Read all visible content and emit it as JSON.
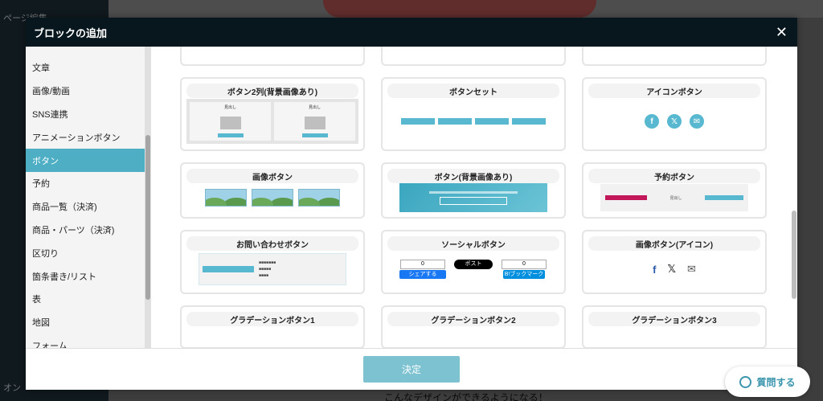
{
  "background": {
    "sidebar_rows": [
      "ページ編集",
      "オン"
    ],
    "footer_text": "こんなデザインができるようになる！"
  },
  "modal": {
    "title": "ブロックの追加",
    "close_label": "✕",
    "confirm_label": "決定"
  },
  "sidebar": {
    "items": [
      {
        "label": "文章"
      },
      {
        "label": "画像/動画"
      },
      {
        "label": "SNS連携"
      },
      {
        "label": "アニメーションボタン"
      },
      {
        "label": "ボタン",
        "active": true
      },
      {
        "label": "予約"
      },
      {
        "label": "商品一覧（決済)"
      },
      {
        "label": "商品・パーツ（決済)"
      },
      {
        "label": "区切り"
      },
      {
        "label": "箇条書き/リスト"
      },
      {
        "label": "表"
      },
      {
        "label": "地図"
      },
      {
        "label": "フォーム"
      }
    ]
  },
  "cards": {
    "button_2col_bg": "ボタン2列(背景画像あり)",
    "button_set": "ボタンセット",
    "icon_button": "アイコンボタン",
    "image_button": "画像ボタン",
    "button_bg_image": "ボタン(背景画像あり)",
    "reserve_button": "予約ボタン",
    "contact_button": "お問い合わせボタン",
    "social_button": "ソーシャルボタン",
    "image_button_icon": "画像ボタン(アイコン)",
    "gradient_1": "グラデーションボタン1",
    "gradient_2": "グラデーションボタン2",
    "gradient_3": "グラデーションボタン3"
  },
  "thumb_text": {
    "heading": "見出し",
    "share_count": "0",
    "fb_share": "シェアする",
    "x_post": "ポスト",
    "hatena": "B!ブックマーク"
  },
  "help": {
    "label": "質問する"
  }
}
